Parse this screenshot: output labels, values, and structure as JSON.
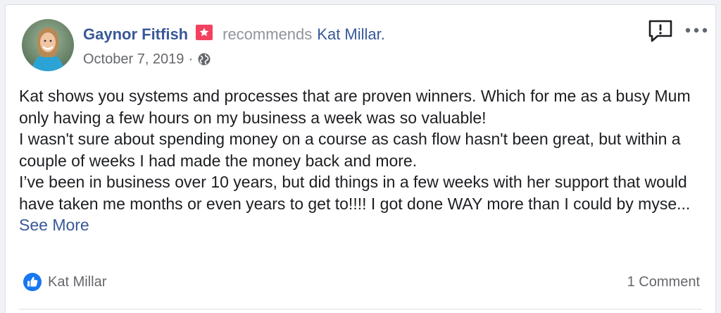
{
  "post": {
    "author": {
      "name": "Gaynor Fitfish",
      "avatar_icon": "profile-photo",
      "badge_icon": "star-badge-icon"
    },
    "action_text": "recommends",
    "target_page": "Kat Millar.",
    "date": "October 7, 2019",
    "separator": "·",
    "privacy_icon": "globe-icon",
    "body_lines": [
      "Kat shows you systems and processes that are proven winners. Which for me as a busy Mum only having a few hours on my business a week was so valuable!",
      "I wasn't sure about spending money on a course as cash flow hasn't been great, but within a couple of weeks I had made the money back and more.",
      "I’ve been in business over 10 years, but did things in a few weeks with her support that would have taken me months or even years to get to!!!! I got done WAY more than I could by myse..."
    ],
    "see_more_label": "See More"
  },
  "toolbar": {
    "report_icon": "report-icon",
    "more_icon": "more-options-icon"
  },
  "footer": {
    "like_icon": "like-icon",
    "reactor_name": "Kat Millar",
    "comment_count": "1 Comment"
  },
  "colors": {
    "link": "#385898",
    "muted": "#90949c",
    "body_text": "#1c1e21",
    "badge": "#f3425f",
    "like": "#1877f2"
  }
}
